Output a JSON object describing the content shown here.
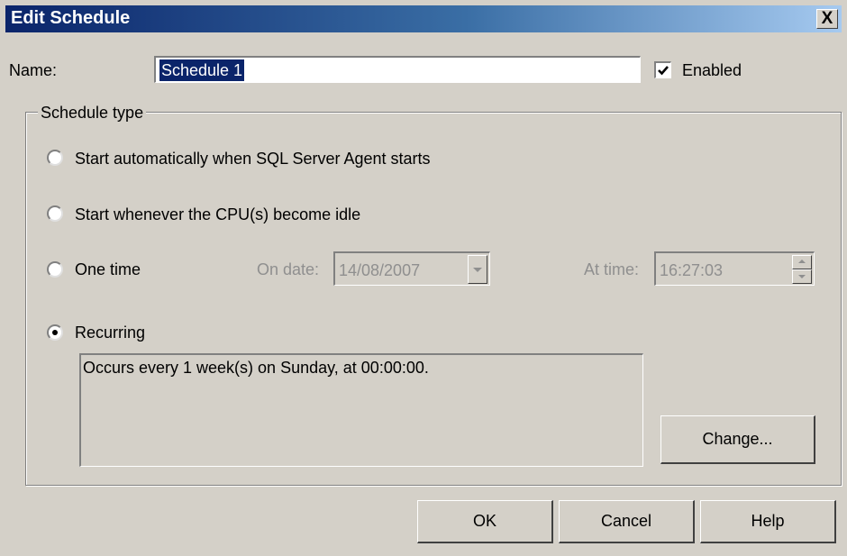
{
  "window": {
    "title": "Edit Schedule",
    "close_label": "X"
  },
  "name": {
    "label": "Name:",
    "value": "Schedule 1"
  },
  "enabled": {
    "label": "Enabled",
    "checked": true
  },
  "schedule_type": {
    "legend": "Schedule type",
    "options": [
      {
        "label": "Start automatically when SQL Server Agent starts",
        "selected": false
      },
      {
        "label": "Start whenever the CPU(s) become idle",
        "selected": false
      },
      {
        "label": "One time",
        "selected": false
      },
      {
        "label": "Recurring",
        "selected": true
      }
    ],
    "one_time": {
      "date_label": "On date:",
      "date_value": "14/08/2007",
      "time_label": "At time:",
      "time_value": "16:27:03"
    },
    "recurring_description": "Occurs every 1 week(s) on Sunday, at 00:00:00.",
    "change_button": "Change..."
  },
  "buttons": {
    "ok": "OK",
    "cancel": "Cancel",
    "help": "Help"
  },
  "colors": {
    "dialog_bg": "#d4d0c8",
    "title_start": "#0a246a",
    "title_end": "#a6caf0",
    "selection": "#0a246a",
    "disabled_text": "#8f8f8f"
  }
}
